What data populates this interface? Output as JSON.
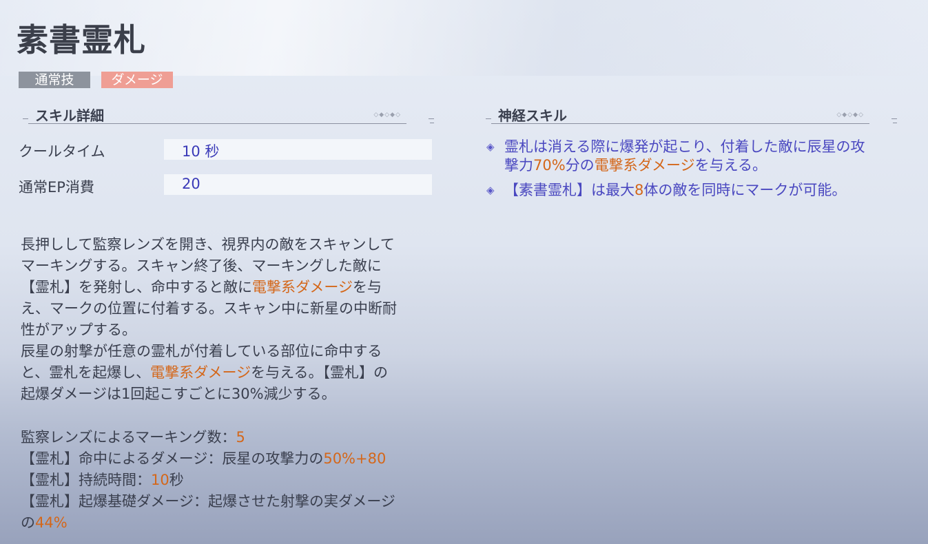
{
  "title": "素書霊札",
  "tags": [
    "通常技",
    "ダメージ"
  ],
  "left_section": {
    "heading": "スキル詳細",
    "stats": [
      {
        "label": "クールタイム",
        "value": "10 秒"
      },
      {
        "label": "通常EP消費",
        "value": "20"
      }
    ],
    "description_lines": [
      [
        {
          "t": "長押しして監察レンズを開き、視界内の敵をスキャンして"
        }
      ],
      [
        {
          "t": "マーキングする。スキャン終了後、マーキングした敵に"
        }
      ],
      [
        {
          "t": "【霊札】を発射し、命中すると敵に"
        },
        {
          "t": "電撃系ダメージ",
          "h": true
        },
        {
          "t": "を与"
        }
      ],
      [
        {
          "t": "え、マークの位置に付着する。スキャン中に新星の中断耐"
        }
      ],
      [
        {
          "t": "性がアップする。"
        }
      ],
      [
        {
          "t": "辰星の射撃が任意の霊札が付着している部位に命中する"
        }
      ],
      [
        {
          "t": "と、霊札を起爆し、"
        },
        {
          "t": "電撃系ダメージ",
          "h": true
        },
        {
          "t": "を与える。【霊札】の"
        }
      ],
      [
        {
          "t": "起爆ダメージは1回起こすごとに30%減少する。"
        }
      ]
    ],
    "detail_lines": [
      [
        {
          "t": "監察レンズによるマーキング数："
        },
        {
          "t": "5",
          "h": true
        }
      ],
      [
        {
          "t": "【霊札】命中によるダメージ：辰星の攻撃力の"
        },
        {
          "t": "50%+80",
          "h": true
        }
      ],
      [
        {
          "t": "【霊札】持続時間："
        },
        {
          "t": "10",
          "h": true
        },
        {
          "t": "秒"
        }
      ],
      [
        {
          "t": "【霊札】起爆基礎ダメージ：起爆させた射撃の実ダメージ"
        }
      ],
      [
        {
          "t": "の"
        },
        {
          "t": "44%",
          "h": true
        }
      ]
    ]
  },
  "right_section": {
    "heading": "神経スキル",
    "bullets": [
      {
        "icon": "diamond-bullet-icon",
        "lines": [
          [
            {
              "t": "霊札は消える際に爆発が起こり、付着した敵に辰星の攻"
            }
          ],
          [
            {
              "t": "撃力"
            },
            {
              "t": "70%",
              "h": true
            },
            {
              "t": "分の"
            },
            {
              "t": "電撃系ダメージ",
              "h": true
            },
            {
              "t": "を与える。"
            }
          ]
        ]
      },
      {
        "icon": "diamond-bullet-icon",
        "lines": [
          [
            {
              "t": "【素書霊札】は最大"
            },
            {
              "t": "8",
              "h": true
            },
            {
              "t": "体の敵を同時にマークが可能。"
            }
          ]
        ]
      }
    ]
  },
  "colors": {
    "highlight": "#d4671a",
    "stat_value": "#3a3ab8",
    "bullet_text": "#4a48c0",
    "tag_gray": "#8d939d",
    "tag_red": "#ef9e94"
  }
}
